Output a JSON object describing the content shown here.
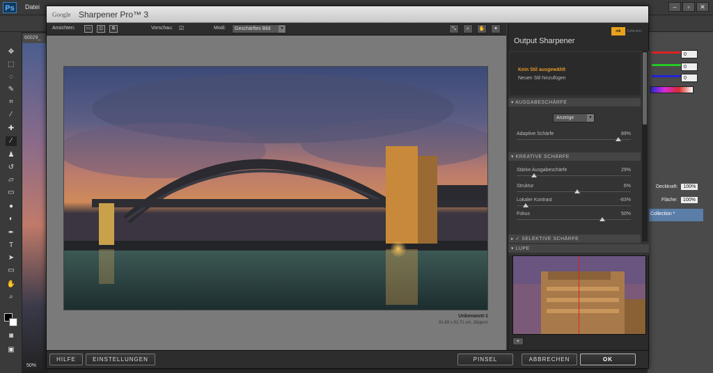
{
  "photoshop": {
    "logo": "Ps",
    "menu_first": "Datei",
    "doc_tab": "60029_",
    "zoom": "50%",
    "window_buttons": [
      "–",
      "▫",
      "✕"
    ],
    "color_values": [
      "0",
      "0",
      "0"
    ],
    "layers": {
      "opacity_label": "Deckkraft:",
      "opacity_value": "100%",
      "fill_label": "Fläche:",
      "fill_value": "100%",
      "layer_name": "Collection *"
    }
  },
  "dialog": {
    "brand_google": "Google",
    "title": "Sharpener Pro™ 3",
    "toolbar": {
      "views_label": "Ansichten:",
      "preview_label": "Vorschau:",
      "preview_checked": "☑",
      "mode_label": "Modi:",
      "mode_value": "Geschärftes Bild"
    },
    "image": {
      "name": "Unbenannt-1",
      "size": "91,69 x 52,71 cm, 28ppcm"
    },
    "panel": {
      "logo_text": "Collection",
      "title": "Output Sharpener",
      "style_name": "Kein Stil ausgewählt",
      "add_style": "Neuen Stil hinzufügen",
      "sections": {
        "output": "AUSGABESCHÄRFE",
        "creative": "KREATIVE SCHÄRFE",
        "selective": "✓ SELEKTIVE SCHÄRFE",
        "loupe": "LUPE"
      },
      "display_select": "Anzeige",
      "sliders": [
        {
          "label": "Adaptive Schärfe",
          "value": "89%",
          "level": 0.89
        },
        {
          "label": "Stärke Ausgabeschärfe",
          "value": "29%",
          "level": 0.15
        },
        {
          "label": "Struktur",
          "value": "6%",
          "level": 0.53
        },
        {
          "label": "Lokaler Kontrast",
          "value": "-83%",
          "level": 0.08
        },
        {
          "label": "Fokus",
          "value": "50%",
          "level": 0.75
        }
      ]
    },
    "buttons": {
      "help": "HILFE",
      "settings": "EINSTELLUNGEN",
      "brush": "PINSEL",
      "cancel": "ABBRECHEN",
      "ok": "OK"
    }
  },
  "colors": {
    "accent_orange": "#e0962c",
    "nik_logo": "#e8a21c",
    "layer_selected": "#5b7ea8"
  }
}
